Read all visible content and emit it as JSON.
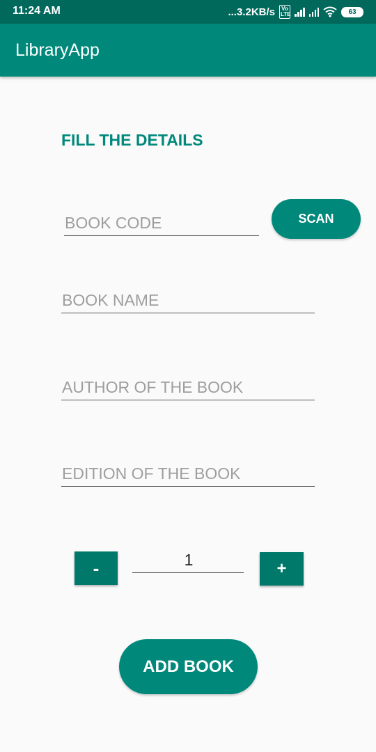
{
  "status_bar": {
    "time": "11:24 AM",
    "network_speed": "...3.2KB/s",
    "volte_label": "Vo LTE",
    "battery_level": "63"
  },
  "app_bar": {
    "title": "LibraryApp"
  },
  "form": {
    "heading": "FILL THE DETAILS",
    "book_code_placeholder": "BOOK CODE",
    "scan_label": "SCAN",
    "book_name_placeholder": "BOOK NAME",
    "author_placeholder": "AUTHOR OF THE BOOK",
    "edition_placeholder": "EDITION OF THE BOOK",
    "quantity": {
      "decrement_label": "-",
      "value": "1",
      "increment_label": "+"
    },
    "submit_label": "ADD BOOK"
  },
  "colors": {
    "status_bar": "#00695c",
    "primary": "#00897b",
    "background": "#fafafa",
    "placeholder": "#9e9e9e"
  },
  "icons": [
    "signal-icon",
    "wifi-icon",
    "battery-icon",
    "volte-icon"
  ]
}
